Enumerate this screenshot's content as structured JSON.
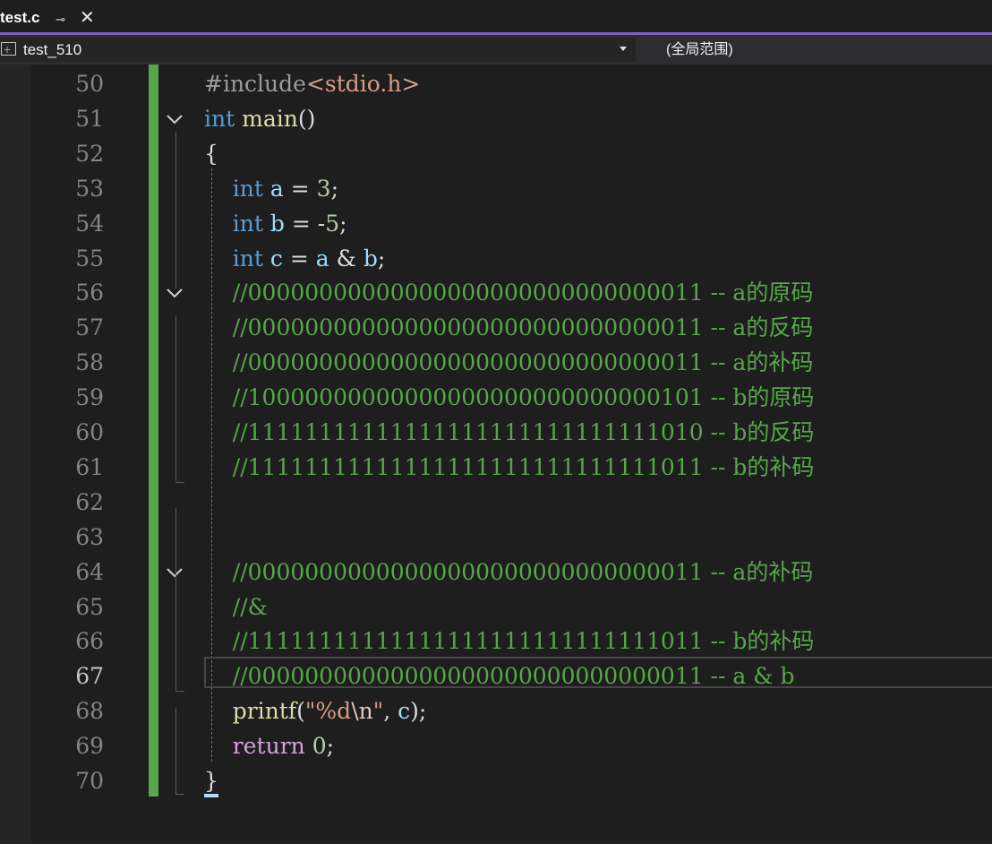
{
  "tab": {
    "title": "test.c",
    "pin_glyph": "⊸",
    "close_glyph": "✕"
  },
  "nav": {
    "project": "test_510",
    "scope": "(全局范围)"
  },
  "lines": [
    {
      "n": "50",
      "tokens": [
        {
          "t": "#include",
          "c": "inc"
        },
        {
          "t": "<stdio.h>",
          "c": "str"
        }
      ]
    },
    {
      "n": "51",
      "tokens": [
        {
          "t": "int",
          "c": "kw"
        },
        {
          "t": " ",
          "c": ""
        },
        {
          "t": "main",
          "c": "fn"
        },
        {
          "t": "()",
          "c": ""
        }
      ]
    },
    {
      "n": "52",
      "tokens": [
        {
          "t": "{",
          "c": ""
        }
      ]
    },
    {
      "n": "53",
      "tokens": [
        {
          "t": "    ",
          "c": ""
        },
        {
          "t": "int",
          "c": "kw"
        },
        {
          "t": " ",
          "c": ""
        },
        {
          "t": "a",
          "c": "id"
        },
        {
          "t": " = ",
          "c": ""
        },
        {
          "t": "3",
          "c": "num"
        },
        {
          "t": ";",
          "c": ""
        }
      ]
    },
    {
      "n": "54",
      "tokens": [
        {
          "t": "    ",
          "c": ""
        },
        {
          "t": "int",
          "c": "kw"
        },
        {
          "t": " ",
          "c": ""
        },
        {
          "t": "b",
          "c": "id"
        },
        {
          "t": " = -",
          "c": ""
        },
        {
          "t": "5",
          "c": "num"
        },
        {
          "t": ";",
          "c": ""
        }
      ]
    },
    {
      "n": "55",
      "tokens": [
        {
          "t": "    ",
          "c": ""
        },
        {
          "t": "int",
          "c": "kw"
        },
        {
          "t": " ",
          "c": ""
        },
        {
          "t": "c",
          "c": "id"
        },
        {
          "t": " = ",
          "c": ""
        },
        {
          "t": "a",
          "c": "id"
        },
        {
          "t": " & ",
          "c": ""
        },
        {
          "t": "b",
          "c": "id"
        },
        {
          "t": ";",
          "c": ""
        }
      ]
    },
    {
      "n": "56",
      "tokens": [
        {
          "t": "    ",
          "c": ""
        },
        {
          "t": "//00000000000000000000000000000011 -- a的原码",
          "c": "cm"
        }
      ]
    },
    {
      "n": "57",
      "tokens": [
        {
          "t": "    ",
          "c": ""
        },
        {
          "t": "//00000000000000000000000000000011 -- a的反码",
          "c": "cm"
        }
      ]
    },
    {
      "n": "58",
      "tokens": [
        {
          "t": "    ",
          "c": ""
        },
        {
          "t": "//00000000000000000000000000000011 -- a的补码",
          "c": "cm"
        }
      ]
    },
    {
      "n": "59",
      "tokens": [
        {
          "t": "    ",
          "c": ""
        },
        {
          "t": "//10000000000000000000000000000101 -- b的原码",
          "c": "cm"
        }
      ]
    },
    {
      "n": "60",
      "tokens": [
        {
          "t": "    ",
          "c": ""
        },
        {
          "t": "//11111111111111111111111111111010 -- b的反码",
          "c": "cm"
        }
      ]
    },
    {
      "n": "61",
      "tokens": [
        {
          "t": "    ",
          "c": ""
        },
        {
          "t": "//11111111111111111111111111111011 -- b的补码",
          "c": "cm"
        }
      ]
    },
    {
      "n": "62",
      "tokens": []
    },
    {
      "n": "63",
      "tokens": []
    },
    {
      "n": "64",
      "tokens": [
        {
          "t": "    ",
          "c": ""
        },
        {
          "t": "//00000000000000000000000000000011 -- a的补码",
          "c": "cm"
        }
      ]
    },
    {
      "n": "65",
      "tokens": [
        {
          "t": "    ",
          "c": ""
        },
        {
          "t": "//&",
          "c": "cm"
        }
      ]
    },
    {
      "n": "66",
      "tokens": [
        {
          "t": "    ",
          "c": ""
        },
        {
          "t": "//11111111111111111111111111111011 -- b的补码",
          "c": "cm"
        }
      ]
    },
    {
      "n": "67",
      "current": true,
      "tokens": [
        {
          "t": "    ",
          "c": ""
        },
        {
          "t": "//00000000000000000000000000000011 -- a & b",
          "c": "cm"
        }
      ]
    },
    {
      "n": "68",
      "tokens": [
        {
          "t": "    ",
          "c": ""
        },
        {
          "t": "printf",
          "c": "fn"
        },
        {
          "t": "(",
          "c": ""
        },
        {
          "t": "\"%d",
          "c": "str"
        },
        {
          "t": "\\n",
          "c": "esc"
        },
        {
          "t": "\"",
          "c": "str"
        },
        {
          "t": ", ",
          "c": ""
        },
        {
          "t": "c",
          "c": "id"
        },
        {
          "t": ");",
          "c": ""
        }
      ]
    },
    {
      "n": "69",
      "tokens": [
        {
          "t": "    ",
          "c": ""
        },
        {
          "t": "return",
          "c": "kw2"
        },
        {
          "t": " ",
          "c": ""
        },
        {
          "t": "0",
          "c": "num"
        },
        {
          "t": ";",
          "c": ""
        }
      ]
    },
    {
      "n": "70",
      "tokens": [
        {
          "t": "}",
          "c": ""
        }
      ]
    }
  ],
  "folds": [
    {
      "line": "51",
      "icon": "chevron-down-icon"
    },
    {
      "line": "56",
      "icon": "chevron-down-icon"
    },
    {
      "line": "64",
      "icon": "chevron-down-icon"
    }
  ]
}
